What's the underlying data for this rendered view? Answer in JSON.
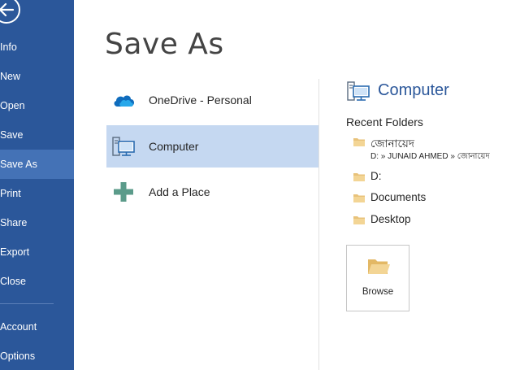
{
  "window": {
    "page_title": "Save As"
  },
  "nav": {
    "items": [
      {
        "label": "Info",
        "active": false
      },
      {
        "label": "New",
        "active": false
      },
      {
        "label": "Open",
        "active": false
      },
      {
        "label": "Save",
        "active": false
      },
      {
        "label": "Save As",
        "active": true
      },
      {
        "label": "Print",
        "active": false
      },
      {
        "label": "Share",
        "active": false
      },
      {
        "label": "Export",
        "active": false
      },
      {
        "label": "Close",
        "active": false
      },
      {
        "label": "Account",
        "active": false
      },
      {
        "label": "Options",
        "active": false
      }
    ]
  },
  "places": [
    {
      "label": "OneDrive - Personal",
      "icon": "onedrive-cloud-icon",
      "selected": false
    },
    {
      "label": "Computer",
      "icon": "computer-icon",
      "selected": true
    },
    {
      "label": "Add a Place",
      "icon": "plus-icon",
      "selected": false
    }
  ],
  "right_pane": {
    "title": "Computer",
    "recent_label": "Recent Folders",
    "folders": [
      {
        "name": "জোনায়েদ",
        "path": "D: » JUNAID AHMED » জোনায়েদ"
      },
      {
        "name": "D:",
        "path": ""
      },
      {
        "name": "Documents",
        "path": ""
      },
      {
        "name": "Desktop",
        "path": ""
      }
    ],
    "browse_label": "Browse"
  },
  "colors": {
    "nav_bg": "#2b579a",
    "nav_active": "#4472b6",
    "selected_place": "#c5d8f1",
    "accent_text": "#2b579a",
    "folder": "#e8c27a"
  }
}
